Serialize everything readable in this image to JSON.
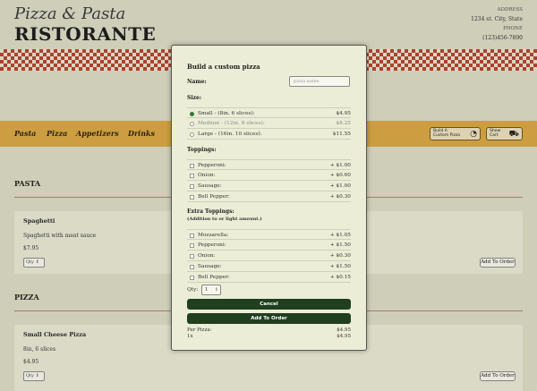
{
  "brand": {
    "line1": "Pizza & Pasta",
    "line2": "RISTORANTE"
  },
  "contact": {
    "address_label": "ADDRESS",
    "address": "1234 st. City, State",
    "phone_label": "PHONE",
    "phone": "(123)456-7890"
  },
  "nav": {
    "items": [
      "Pasta",
      "Pizza",
      "Appetizers",
      "Drinks"
    ],
    "build_label": "Build A Custom Pizza",
    "cart_label": "Show Cart"
  },
  "sections": {
    "pasta": {
      "title": "PASTA",
      "item_name": "Spaghetti",
      "item_desc": "Spaghetti with meat sauce",
      "item_price": "$7.95",
      "qty_label": "Qty",
      "add_label": "Add To Order"
    },
    "pizza": {
      "title": "PIZZA",
      "item_name": "Small Cheese Pizza",
      "item_desc": "8in, 6 slices",
      "item_price": "$4.95",
      "qty_label": "Qty",
      "add_label": "Add To Order"
    }
  },
  "modal": {
    "title": "Build a custom pizza",
    "name_label": "Name:",
    "name_placeholder": "pizza name",
    "size_label": "Size:",
    "sizes": [
      {
        "label": "Small - (8in. 6 slices):",
        "price": "$4.95"
      },
      {
        "label": "Medium - (12in. 8 slices):",
        "price": "$8.25"
      },
      {
        "label": "Large - (16in. 10 slices):",
        "price": "$11.55"
      }
    ],
    "toppings_label": "Toppings:",
    "toppings": [
      {
        "label": "Pepperoni:",
        "price": "+ $1.00"
      },
      {
        "label": "Onion:",
        "price": "+ $0.60"
      },
      {
        "label": "Sausage:",
        "price": "+ $1.00"
      },
      {
        "label": "Bell Pepper:",
        "price": "+ $0.30"
      }
    ],
    "extra_label": "Extra Toppings:",
    "extra_sub": "(Addition to or light amount.)",
    "extras": [
      {
        "label": "Mozzarella:",
        "price": "+ $1.05"
      },
      {
        "label": "Pepperoni:",
        "price": "+ $1.50"
      },
      {
        "label": "Onion:",
        "price": "+ $0.30"
      },
      {
        "label": "Sausage:",
        "price": "+ $1.50"
      },
      {
        "label": "Bell Pepper:",
        "price": "+ $0.15"
      }
    ],
    "qty_label": "Qty:",
    "qty_value": "1",
    "cancel_label": "Cancel",
    "add_label": "Add To Order",
    "per_pizza_label": "Per Pizza:",
    "per_pizza_value": "$4.95",
    "multiplier_label": "1x",
    "multiplier_value": "$4.95"
  }
}
